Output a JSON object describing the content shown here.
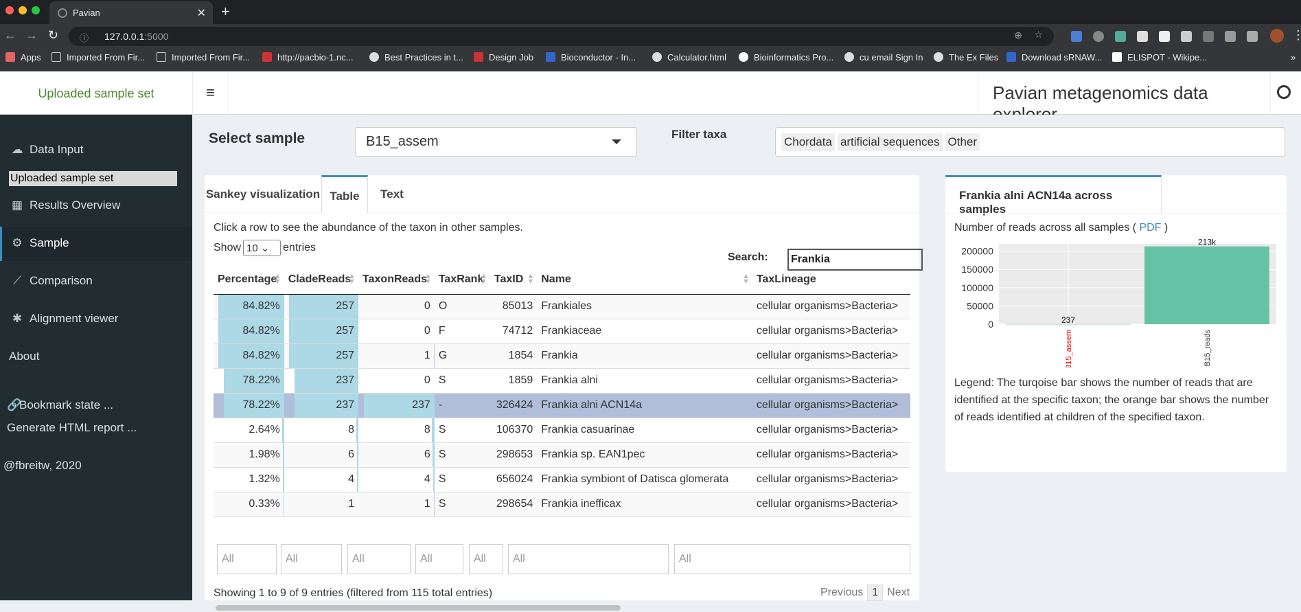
{
  "browser": {
    "tab_title": "Pavian",
    "url_host": "127.0.0.1",
    "url_port": ":5000",
    "bookmarks": [
      "Apps",
      "Imported From Fir...",
      "Imported From Fir...",
      "http://pacbio-1.nc...",
      "Best Practices in t...",
      "Design Job",
      "Bioconductor - In...",
      "Calculator.html",
      "Bioinformatics Pro...",
      "cu email Sign In",
      "The Ex Files",
      "Download sRNAW...",
      "ELISPOT - Wikipe..."
    ]
  },
  "header": {
    "logo": "Uploaded sample set",
    "title": "Pavian metagenomics data explorer"
  },
  "sidebar": {
    "items": [
      {
        "label": "Data Input",
        "icon": "cloud-upload-icon"
      },
      {
        "label": "Uploaded sample set"
      },
      {
        "label": "Results Overview",
        "icon": "table-icon"
      },
      {
        "label": "Sample",
        "icon": "gear-icon"
      },
      {
        "label": "Comparison",
        "icon": "line-chart-icon"
      },
      {
        "label": "Alignment viewer",
        "icon": "asterisk-icon"
      },
      {
        "label": "About"
      }
    ],
    "bookmark": "Bookmark state ...",
    "report": "Generate HTML report ...",
    "credit": "@fbreitw, 2020"
  },
  "main": {
    "select_label": "Select sample",
    "selected_sample": "B15_assem",
    "filter_label": "Filter taxa",
    "filter_chips": [
      "Chordata",
      "artificial sequences",
      "Other"
    ],
    "tabs": [
      "Sankey visualization",
      "Table",
      "Text"
    ],
    "hint": "Click a row to see the abundance of the taxon in other samples.",
    "show_pre": "Show",
    "show_value": "10",
    "show_post": "entries",
    "search_label": "Search:",
    "search_value": "Frankia",
    "columns": [
      "Percentage",
      "CladeReads",
      "TaxonReads",
      "TaxRank",
      "TaxID",
      "Name",
      "TaxLineage"
    ],
    "rows": [
      {
        "pct": "84.82%",
        "clade": "257",
        "taxon": "0",
        "rank": "O",
        "taxid": "85013",
        "name": "Frankiales",
        "lineage": "cellular organisms>Bacteria>"
      },
      {
        "pct": "84.82%",
        "clade": "257",
        "taxon": "0",
        "rank": "F",
        "taxid": "74712",
        "name": "Frankiaceae",
        "lineage": "cellular organisms>Bacteria>"
      },
      {
        "pct": "84.82%",
        "clade": "257",
        "taxon": "1",
        "rank": "G",
        "taxid": "1854",
        "name": "Frankia",
        "lineage": "cellular organisms>Bacteria>"
      },
      {
        "pct": "78.22%",
        "clade": "237",
        "taxon": "0",
        "rank": "S",
        "taxid": "1859",
        "name": "Frankia alni",
        "lineage": "cellular organisms>Bacteria>"
      },
      {
        "pct": "78.22%",
        "clade": "237",
        "taxon": "237",
        "rank": "-",
        "taxid": "326424",
        "name": "Frankia alni ACN14a",
        "lineage": "cellular organisms>Bacteria>"
      },
      {
        "pct": "2.64%",
        "clade": "8",
        "taxon": "8",
        "rank": "S",
        "taxid": "106370",
        "name": "Frankia casuarinae",
        "lineage": "cellular organisms>Bacteria>"
      },
      {
        "pct": "1.98%",
        "clade": "6",
        "taxon": "6",
        "rank": "S",
        "taxid": "298653",
        "name": "Frankia sp. EAN1pec",
        "lineage": "cellular organisms>Bacteria>"
      },
      {
        "pct": "1.32%",
        "clade": "4",
        "taxon": "4",
        "rank": "S",
        "taxid": "656024",
        "name": "Frankia symbiont of Datisca glomerata",
        "lineage": "cellular organisms>Bacteria>"
      },
      {
        "pct": "0.33%",
        "clade": "1",
        "taxon": "1",
        "rank": "S",
        "taxid": "298654",
        "name": "Frankia inefficax",
        "lineage": "cellular organisms>Bacteria>"
      }
    ],
    "filter_placeholder": "All",
    "info": "Showing 1 to 9 of 9 entries (filtered from 115 total entries)",
    "pager": {
      "prev": "Previous",
      "page": "1",
      "next": "Next"
    }
  },
  "right": {
    "tab": "Frankia alni ACN14a across samples",
    "reads_pre": "Number of reads across all samples (",
    "pdf": "PDF",
    "reads_post": ")",
    "legend": "Legend: The turqoise bar shows the number of reads that are identified at the specific taxon; the orange bar shows the number of reads identified at children of the specified taxon."
  },
  "chart_data": {
    "type": "bar",
    "categories": [
      "B15_assem",
      "B15_reads"
    ],
    "values": [
      237,
      213000
    ],
    "data_labels": [
      "237",
      "213k"
    ],
    "ylim": [
      0,
      220000
    ],
    "yticks": [
      0,
      50000,
      100000,
      150000,
      200000
    ],
    "bar_color": "#66c2a5",
    "highlight_category_color": "#ff0000"
  }
}
